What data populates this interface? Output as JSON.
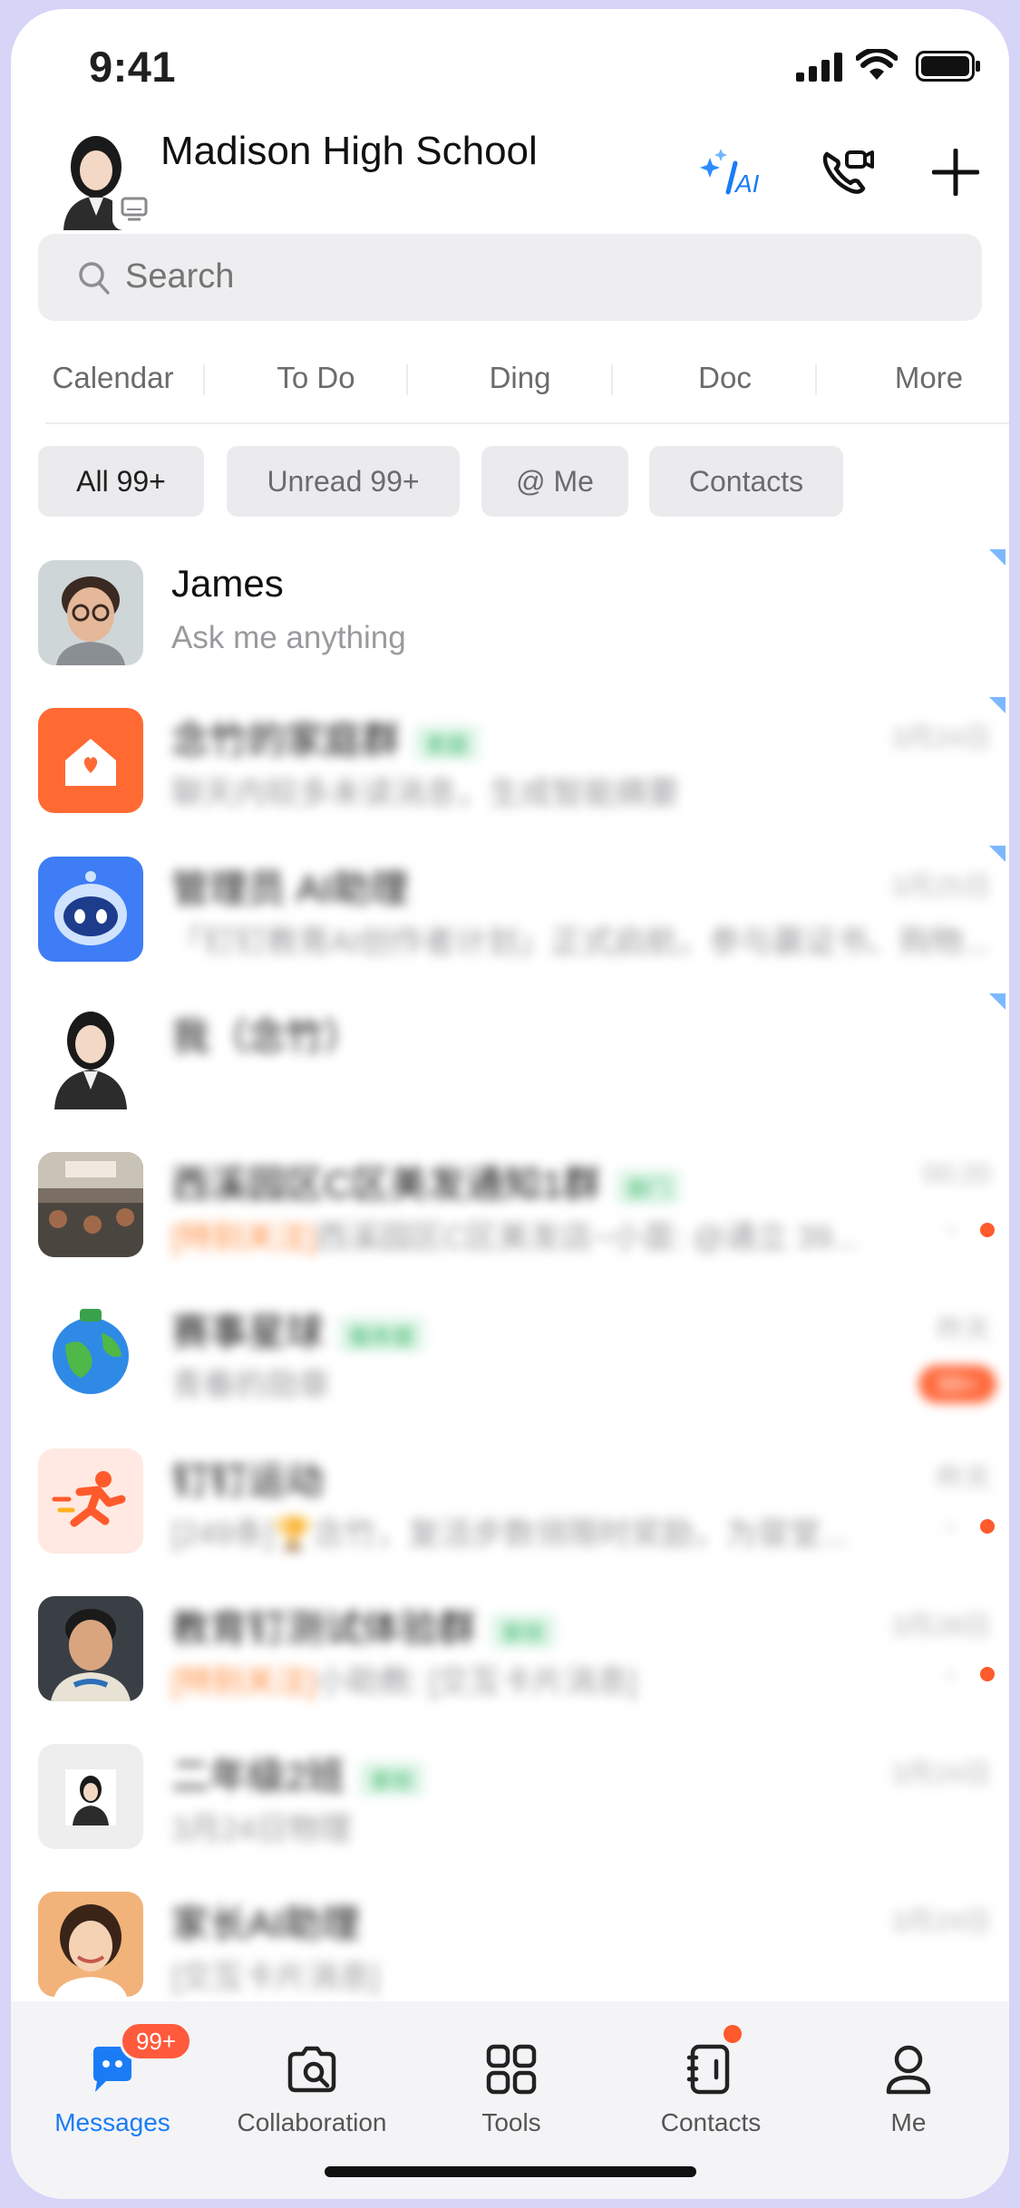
{
  "status_bar": {
    "time": "9:41"
  },
  "header": {
    "title": "Madison High School",
    "ai_label": "AI"
  },
  "search": {
    "placeholder": "Search"
  },
  "quick_nav": [
    "Calendar",
    "To Do",
    "Ding",
    "Doc",
    "More"
  ],
  "filters": [
    {
      "label": "All 99+",
      "active": true
    },
    {
      "label": "Unread 99+",
      "active": false
    },
    {
      "label": "@ Me",
      "active": false
    },
    {
      "label": "Contacts",
      "active": false
    }
  ],
  "conversations": [
    {
      "name": "James",
      "preview": "Ask me anything",
      "time": "",
      "tag": "",
      "highlight": "",
      "badge": ""
    },
    {
      "name": "念竹的家庭群",
      "tag": "家庭",
      "time": "3月24日",
      "highlight": "",
      "preview": "聊天内较多未读消息，生成智能摘要",
      "badge": ""
    },
    {
      "name": "管理员 AI助理",
      "tag": "",
      "time": "3月25日",
      "highlight": "",
      "preview": "「钉钉教育AI创作者计划」正式启航，参与赢证书、购物...",
      "badge": ""
    },
    {
      "name": "我（念竹）",
      "tag": "",
      "time": "",
      "highlight": "",
      "preview": "",
      "badge": ""
    },
    {
      "name": "西溪园区C区美发通知1群",
      "tag": "部门",
      "time": "00:20",
      "highlight": "[特别关注]",
      "preview": "西溪园区C区美发店~小苗: @通立 39...",
      "badge": ""
    },
    {
      "name": "赛事星球",
      "tag": "服务窗",
      "time": "昨天",
      "highlight": "",
      "preview": "青春的勋章",
      "badge": "99+"
    },
    {
      "name": "钉钉运动",
      "tag": "",
      "time": "昨天",
      "highlight": "",
      "preview": "[249条]🏆念竹，复活步数领限时奖励，为冒堂...",
      "badge": ""
    },
    {
      "name": "教育钉测试体验群",
      "tag": "家校",
      "time": "3月28日",
      "highlight": "[特别关注]",
      "preview": "小助教: [交互卡片消息]",
      "badge": ""
    },
    {
      "name": "二年级2班",
      "tag": "家校",
      "time": "3月24日",
      "highlight": "",
      "preview": "3月24日物理",
      "badge": ""
    },
    {
      "name": "家长AI助理",
      "tag": "",
      "time": "3月24日",
      "highlight": "",
      "preview": "[交互卡片消息]",
      "badge": ""
    }
  ],
  "tabs": [
    {
      "label": "Messages",
      "icon": "messages-icon",
      "badge": "99+"
    },
    {
      "label": "Collaboration",
      "icon": "collaboration-icon"
    },
    {
      "label": "Tools",
      "icon": "tools-icon"
    },
    {
      "label": "Contacts",
      "icon": "contacts-icon"
    },
    {
      "label": "Me",
      "icon": "me-icon"
    }
  ],
  "colors": {
    "accent": "#1a7cf5",
    "badge": "#ff5a3c",
    "tag": "#2fb463"
  }
}
